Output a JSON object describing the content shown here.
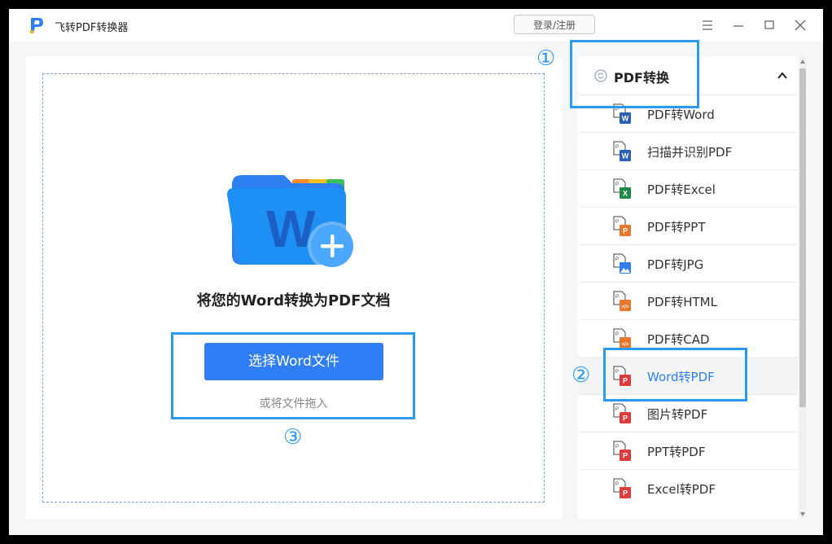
{
  "titlebar": {
    "app_name": "飞转PDF转换器",
    "login_label": "登录/注册",
    "controls": [
      "menu-icon",
      "minimize-icon",
      "maximize-icon",
      "close-icon"
    ]
  },
  "drop_zone": {
    "title": "将您的Word转换为PDF文档",
    "select_button": "选择Word文件",
    "drag_hint": "或将文件拖入",
    "folder_letter": "W"
  },
  "sidebar": {
    "section_title": "PDF转换",
    "items": [
      {
        "label": "PDF转Word",
        "icon": "word-file-icon",
        "badge": "W",
        "color": "#2b5fb8"
      },
      {
        "label": "扫描并识别PDF",
        "icon": "scan-ocr-icon",
        "badge": "W",
        "color": "#2b5fb8"
      },
      {
        "label": "PDF转Excel",
        "icon": "excel-file-icon",
        "badge": "X",
        "color": "#1f8a45"
      },
      {
        "label": "PDF转PPT",
        "icon": "ppt-file-icon",
        "badge": "P",
        "color": "#e8782b"
      },
      {
        "label": "PDF转JPG",
        "icon": "image-file-icon",
        "badge": "",
        "color": "#2f7ef5"
      },
      {
        "label": "PDF转HTML",
        "icon": "html-file-icon",
        "badge": "</>",
        "color": "#e8782b"
      },
      {
        "label": "PDF转CAD",
        "icon": "cad-file-icon",
        "badge": "</>",
        "color": "#e8782b"
      },
      {
        "label": "Word转PDF",
        "icon": "pdf-file-icon",
        "badge": "P",
        "color": "#e03a3a"
      },
      {
        "label": "图片转PDF",
        "icon": "pdf-file-icon",
        "badge": "P",
        "color": "#e03a3a"
      },
      {
        "label": "PPT转PDF",
        "icon": "pdf-file-icon",
        "badge": "P",
        "color": "#e03a3a"
      },
      {
        "label": "Excel转PDF",
        "icon": "pdf-file-icon",
        "badge": "P",
        "color": "#e03a3a"
      }
    ],
    "active_index": 7
  },
  "annotations": {
    "one": "①",
    "two": "②",
    "three": "③"
  },
  "colors": {
    "accent": "#2f7ef5",
    "annotation": "#2b9af3"
  }
}
